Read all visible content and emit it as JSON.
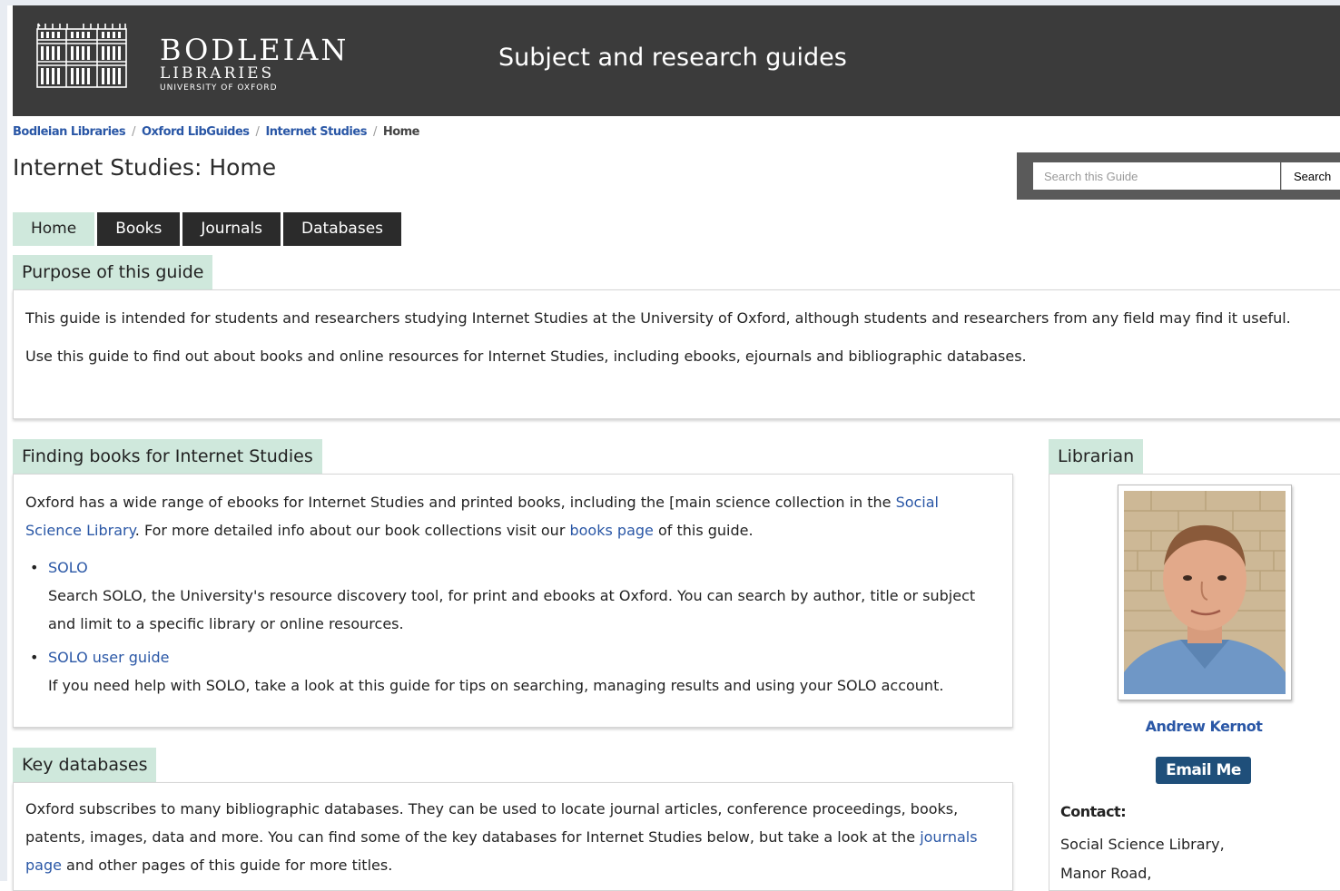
{
  "header": {
    "logo_line1": "BODLEIAN",
    "logo_line2": "LIBRARIES",
    "logo_line3": "UNIVERSITY OF OXFORD",
    "site_title": "Subject and research guides"
  },
  "breadcrumb": {
    "items": [
      "Bodleian Libraries",
      "Oxford LibGuides",
      "Internet Studies"
    ],
    "current": "Home"
  },
  "page_title": "Internet Studies: Home",
  "search": {
    "placeholder": "Search this Guide",
    "button_label": "Search"
  },
  "tabs": [
    {
      "label": "Home",
      "active": true
    },
    {
      "label": "Books",
      "active": false
    },
    {
      "label": "Journals",
      "active": false
    },
    {
      "label": "Databases",
      "active": false
    }
  ],
  "purpose": {
    "heading": "Purpose of this guide",
    "p1": "This guide is intended for students and researchers studying Internet Studies at the University of Oxford, although students and researchers from any field may find it useful.",
    "p2": "Use this guide to find out about books and online resources for Internet Studies, including ebooks, ejournals and bibliographic databases."
  },
  "books": {
    "heading": "Finding books for Internet Studies",
    "intro_a": "Oxford has a wide range of ebooks for Internet Studies and printed books, including the [main science collection in the ",
    "intro_link1": "Social Science Library",
    "intro_b": ".  For more detailed info about our book collections visit our ",
    "intro_link2": "books page",
    "intro_c": " of this guide.",
    "items": [
      {
        "title": "SOLO",
        "desc": "Search SOLO, the University's resource discovery tool, for print and ebooks at Oxford. You can search by author, title or subject and limit to a specific library or online resources."
      },
      {
        "title": "SOLO user guide",
        "desc": "If you need help with SOLO, take a look at this guide for tips on searching, managing results and using your SOLO account."
      }
    ]
  },
  "databases": {
    "heading": "Key databases",
    "text_a": "Oxford subscribes to many bibliographic databases. They can be used to locate journal articles, conference proceedings, books, patents, images, data and more. You can find some of the key databases for Internet Studies below, but take a look at the ",
    "link": "jour­nals page",
    "text_b": " and other pages of this guide for more titles."
  },
  "librarian": {
    "heading": "Librarian",
    "name": "Andrew Kernot",
    "email_label": "Email Me",
    "contact_label": "Contact:",
    "contact_lines": [
      "Social Science Library,",
      "Manor Road,"
    ]
  },
  "colors": {
    "banner": "#3b3b3b",
    "tab_dark": "#2b2b2b",
    "tab_active": "#cfe8dc",
    "panel_head": "#cfe8dc",
    "link": "#2a57a6",
    "email_button": "#1f4f7a"
  }
}
